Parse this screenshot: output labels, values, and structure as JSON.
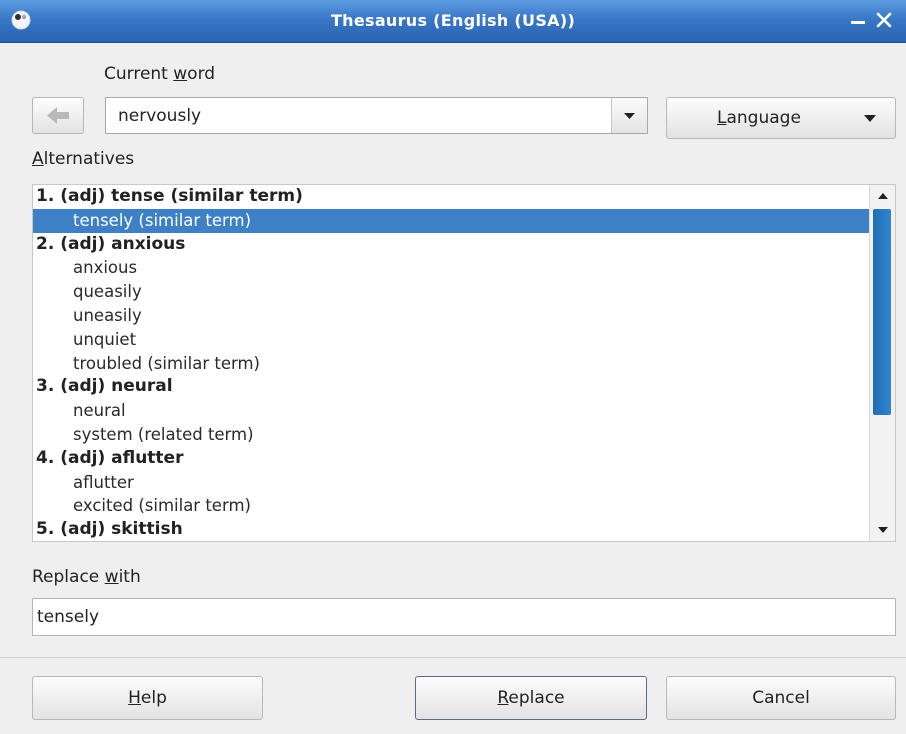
{
  "window": {
    "title": "Thesaurus (English (USA))"
  },
  "current_word": {
    "label_prefix": "Current ",
    "label_accel": "w",
    "label_suffix": "ord",
    "value": "nervously"
  },
  "language_button": {
    "accel": "L",
    "rest": "anguage"
  },
  "alternatives": {
    "label_accel": "A",
    "label_rest": "lternatives",
    "rows": [
      {
        "text": "1. (adj) tense (similar term)",
        "kind": "header"
      },
      {
        "text": "tensely (similar term)",
        "kind": "item",
        "selected": true
      },
      {
        "text": "2. (adj) anxious",
        "kind": "header"
      },
      {
        "text": "anxious",
        "kind": "item"
      },
      {
        "text": "queasily",
        "kind": "item"
      },
      {
        "text": "uneasily",
        "kind": "item"
      },
      {
        "text": "unquiet",
        "kind": "item"
      },
      {
        "text": "troubled (similar term)",
        "kind": "item"
      },
      {
        "text": "3. (adj) neural",
        "kind": "header"
      },
      {
        "text": "neural",
        "kind": "item"
      },
      {
        "text": "system (related term)",
        "kind": "item"
      },
      {
        "text": "4. (adj) aflutter",
        "kind": "header"
      },
      {
        "text": "aflutter",
        "kind": "item"
      },
      {
        "text": "excited (similar term)",
        "kind": "item"
      },
      {
        "text": "5. (adj) skittish",
        "kind": "header"
      }
    ]
  },
  "replace_with": {
    "label_prefix": "Replace ",
    "label_accel": "w",
    "label_suffix": "ith",
    "value": "tensely"
  },
  "buttons": {
    "help": {
      "accel": "H",
      "rest": "elp"
    },
    "replace": {
      "accel": "R",
      "rest": "eplace"
    },
    "cancel": {
      "label": "Cancel"
    }
  },
  "colors": {
    "titlebar": "#3977c8",
    "selection": "#3d80c6",
    "scrollbar_thumb": "#2f86cf"
  },
  "icons": [
    "app-icon",
    "minimize-icon",
    "close-icon",
    "back-arrow-icon",
    "dropdown-arrow-icon",
    "scroll-up-icon",
    "scroll-down-icon"
  ]
}
